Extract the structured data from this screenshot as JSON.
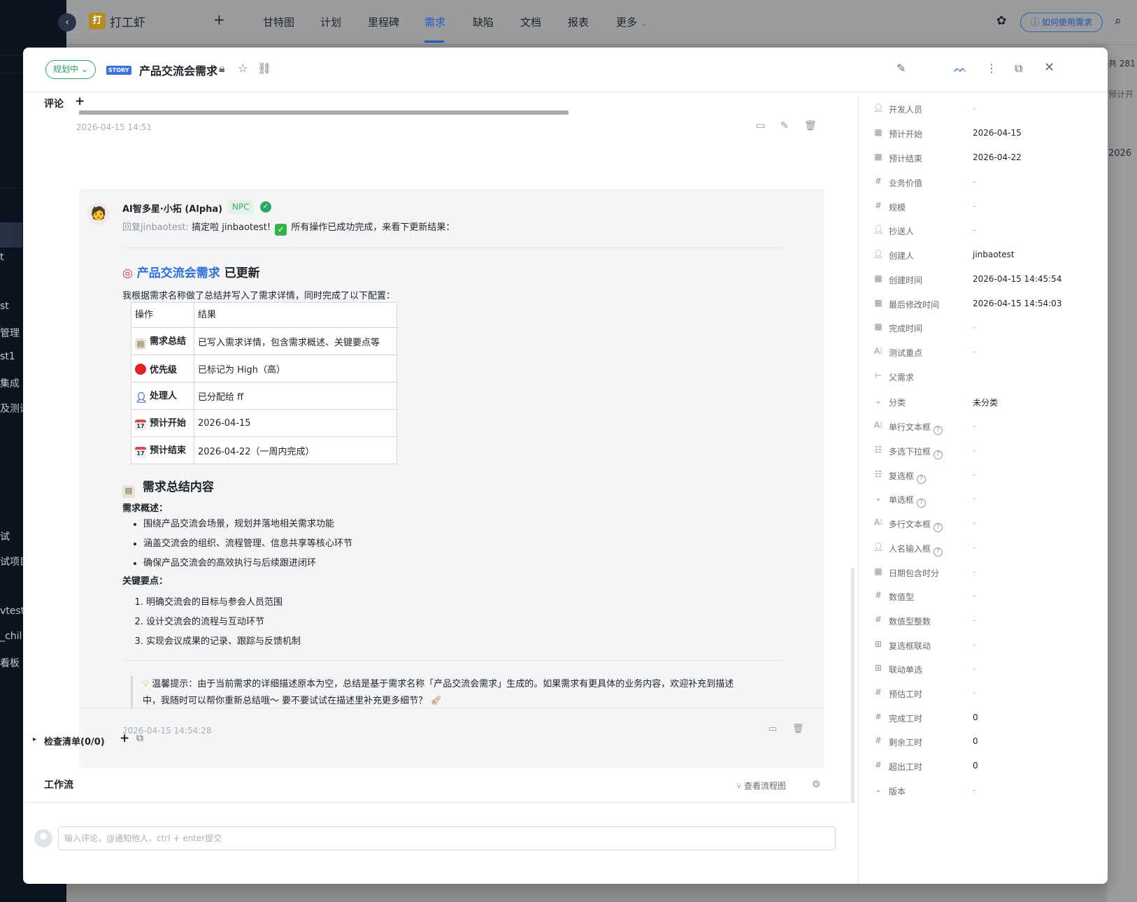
{
  "background": {
    "sidebar_items": [
      "t",
      "st",
      "管理",
      "st1",
      "集成",
      "及测试",
      "试",
      "试项目",
      "vtest",
      "_chil",
      "看板"
    ],
    "app_name": "打工虾",
    "app_logo_char": "打",
    "nav_tabs": [
      "甘特图",
      "计划",
      "里程碑",
      "需求",
      "缺陷",
      "文档",
      "报表",
      "更多"
    ],
    "active_tab": "需求",
    "help_button": "如何使用需求",
    "right_peek": [
      "共 281",
      "预计开",
      "2026"
    ]
  },
  "modal": {
    "status": "规划中",
    "type_badge": "STORY",
    "title": "产品交流会需求",
    "comments_label": "评论",
    "first_timestamp": "2026-04-15 14:51",
    "reply": {
      "author": "AI智多星·小拓 (Alpha)",
      "author_badge": "NPC",
      "reply_to": "回复jinbaotest:",
      "reply_text_1": "搞定啦 jinbaotest!",
      "reply_text_2": "所有操作已成功完成，来看下更新结果：",
      "heading_link": "产品交流会需求",
      "heading_suffix": "已更新",
      "intro": "我根据需求名称做了总结并写入了需求详情，同时完成了以下配置：",
      "table": {
        "headers": [
          "操作",
          "结果"
        ],
        "rows": [
          {
            "op": "需求总结",
            "res": "已写入需求详情，包含需求概述、关键要点等",
            "icon": "clipboard-icon"
          },
          {
            "op": "优先级",
            "res": "已标记为 High（高）",
            "icon": "red-circle-icon"
          },
          {
            "op": "处理人",
            "res": "已分配给 ff",
            "icon": "person-icon"
          },
          {
            "op": "预计开始",
            "res": "2026-04-15",
            "icon": "calendar-icon"
          },
          {
            "op": "预计结束",
            "res": "2026-04-22（一周内完成）",
            "icon": "calendar-icon"
          }
        ]
      },
      "summary_heading": "需求总结内容",
      "overview_label": "需求概述：",
      "overview_items": [
        "围绕产品交流会场景，规划并落地相关需求功能",
        "涵盖交流会的组织、流程管理、信息共享等核心环节",
        "确保产品交流会的高效执行与后续跟进闭环"
      ],
      "key_points_label": "关键要点：",
      "key_points": [
        "明确交流会的目标与参会人员范围",
        "设计交流会的流程与互动环节",
        "实现会议成果的记录、跟踪与反馈机制"
      ],
      "tip_line1": "温馨提示：由于当前需求的详细描述原本为空，总结是基于需求名称「产品交流会需求」生成的。如果需求有更具体的业务内容，欢迎补充到描述",
      "tip_line2": "中，我随时可以帮你重新总结哦～ 要不要试试在描述里补充更多细节？",
      "timestamp": "2026-04-15 14:54:28"
    },
    "checklist_label": "检查清单(0/0)",
    "workflow_label": "工作流",
    "view_flow": "查看流程图",
    "comment_placeholder": "输入评论，@通知他人，ctrl + enter提交"
  },
  "properties": [
    {
      "icon": "user-icon",
      "label": "开发人员",
      "value": "-"
    },
    {
      "icon": "calendar-icon",
      "label": "预计开始",
      "value": "2026-04-15"
    },
    {
      "icon": "calendar-icon",
      "label": "预计结束",
      "value": "2026-04-22"
    },
    {
      "icon": "hash-icon",
      "label": "业务价值",
      "value": "-"
    },
    {
      "icon": "hash-icon",
      "label": "规模",
      "value": "-"
    },
    {
      "icon": "user-icon",
      "label": "抄送人",
      "value": "-"
    },
    {
      "icon": "user-icon",
      "label": "创建人",
      "value": "jinbaotest"
    },
    {
      "icon": "calendar-icon",
      "label": "创建时间",
      "value": "2026-04-15 14:45:54"
    },
    {
      "icon": "calendar-icon",
      "label": "最后修改时间",
      "value": "2026-04-15 14:54:03"
    },
    {
      "icon": "calendar-icon",
      "label": "完成时间",
      "value": "-"
    },
    {
      "icon": "text-icon",
      "label": "测试重点",
      "value": "-"
    },
    {
      "icon": "tree-icon",
      "label": "父需求",
      "value": ""
    },
    {
      "icon": "select-icon",
      "label": "分类",
      "value": "未分类"
    },
    {
      "icon": "text-icon",
      "label": "单行文本框",
      "value": "-",
      "help": true
    },
    {
      "icon": "list-icon",
      "label": "多选下拉框",
      "value": "-",
      "help": true
    },
    {
      "icon": "list-icon",
      "label": "复选框",
      "value": "-",
      "help": true
    },
    {
      "icon": "select-icon",
      "label": "单选框",
      "value": "-",
      "help": true
    },
    {
      "icon": "text-icon",
      "label": "多行文本框",
      "value": "-",
      "help": true
    },
    {
      "icon": "user-icon",
      "label": "人名输入框",
      "value": "-",
      "help": true
    },
    {
      "icon": "calendar-icon",
      "label": "日期包含时分",
      "value": "-"
    },
    {
      "icon": "hash-icon",
      "label": "数值型",
      "value": "-"
    },
    {
      "icon": "hash-icon",
      "label": "数值型整数",
      "value": "-"
    },
    {
      "icon": "cascade-icon",
      "label": "复选框联动",
      "value": "-"
    },
    {
      "icon": "cascade-icon",
      "label": "联动单选",
      "value": "-"
    },
    {
      "icon": "hash-icon",
      "label": "预估工时",
      "value": "-"
    },
    {
      "icon": "hash-icon",
      "label": "完成工时",
      "value": "0"
    },
    {
      "icon": "hash-icon",
      "label": "剩余工时",
      "value": "0"
    },
    {
      "icon": "hash-icon",
      "label": "超出工时",
      "value": "0"
    },
    {
      "icon": "select-icon",
      "label": "版本",
      "value": "-"
    }
  ]
}
